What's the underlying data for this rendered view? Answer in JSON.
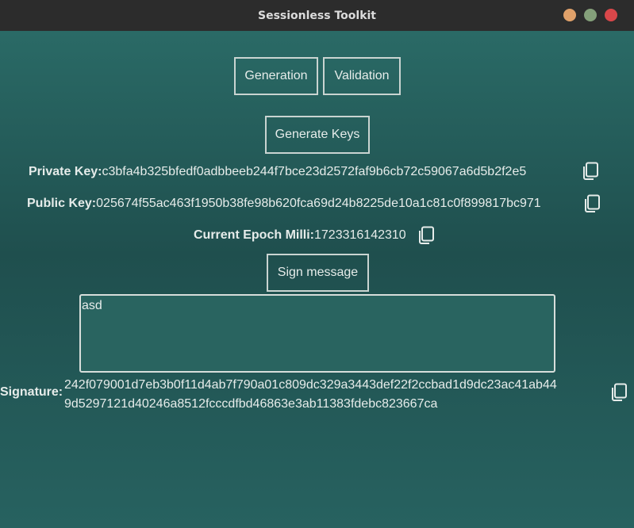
{
  "window": {
    "title": "Sessionless Toolkit"
  },
  "tabs": [
    {
      "label": "Generation"
    },
    {
      "label": "Validation"
    }
  ],
  "generate_button": "Generate Keys",
  "private_key": {
    "label": "Private Key:",
    "value": "c3bfa4b325bfedf0adbbeeb244f7bce23d2572faf9b6cb72c59067a6d5b2f2e5"
  },
  "public_key": {
    "label": "Public Key:",
    "value": "025674f55ac463f1950b38fe98b620fca69d24b8225de10a1c81c0f899817bc971"
  },
  "epoch": {
    "label": "Current Epoch Milli:",
    "value": "1723316142310"
  },
  "sign_button": "Sign message",
  "message": {
    "value": "asd"
  },
  "signature": {
    "label": "Signature:",
    "line1": "242f079001d7eb3b0f11d4ab7f790a01c809dc329a3443def22f2ccbad1d9dc23ac41ab44",
    "line2": "9d5297121d40246a8512fcccdfbd46863e3ab11383fdebc823667ca"
  },
  "colors": {
    "background_top": "#2a6a66",
    "background_mid": "#1f4f4e",
    "titlebar": "#2c2c2c",
    "border": "#c9d4d1"
  },
  "icons": {
    "copy": "copy-icon"
  }
}
